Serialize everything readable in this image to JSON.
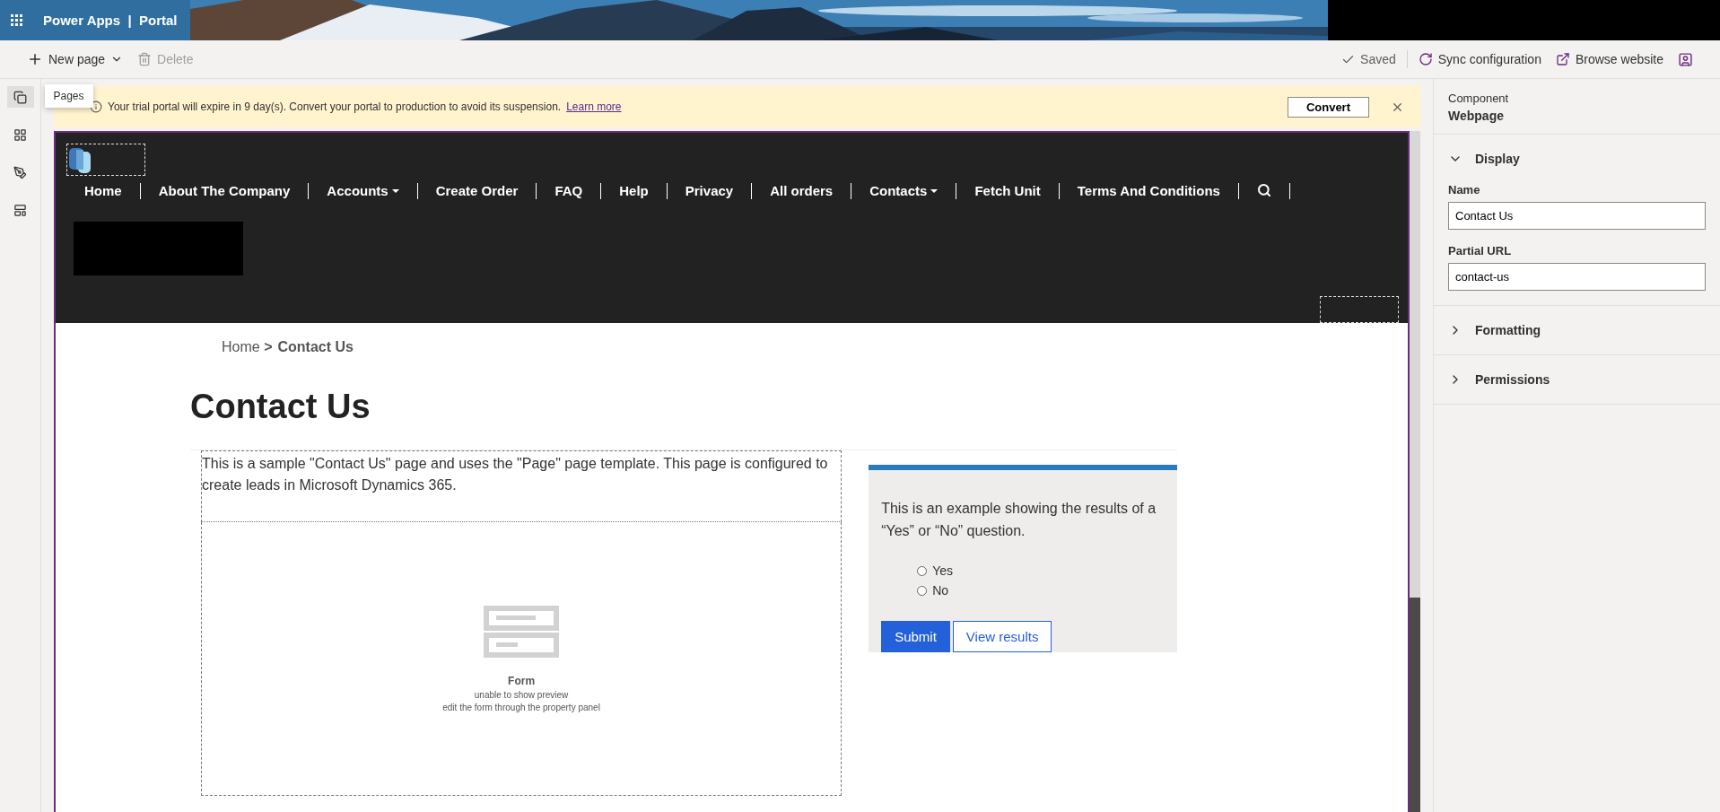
{
  "app_bar": {
    "product": "Power Apps",
    "separator": "|",
    "site": "Portal"
  },
  "toolbar": {
    "left": [
      {
        "kind": "add",
        "label": "New page",
        "disabled": false,
        "dropdown": true
      },
      {
        "kind": "delete",
        "label": "Delete",
        "disabled": true,
        "dropdown": false
      }
    ],
    "right": [
      {
        "kind": "saved",
        "label": "Saved"
      },
      {
        "kind": "sync",
        "label": "Sync configuration"
      },
      {
        "kind": "browse",
        "label": "Browse website"
      },
      {
        "kind": "feedback"
      }
    ]
  },
  "rail": [
    {
      "kind": "pages",
      "selected": true,
      "tooltip": "Pages"
    },
    {
      "kind": "components",
      "selected": false
    },
    {
      "kind": "themes",
      "selected": false
    },
    {
      "kind": "templates",
      "selected": false
    }
  ],
  "banner": {
    "message": "Your trial portal will expire in 9 day(s). Convert your portal to production to avoid its suspension.",
    "link": "Learn more",
    "button": "Convert"
  },
  "site_nav": [
    {
      "label": "Home",
      "dropdown": false
    },
    {
      "label": "About The Company",
      "dropdown": false
    },
    {
      "label": "Accounts",
      "dropdown": true
    },
    {
      "label": "Create Order",
      "dropdown": false
    },
    {
      "label": "FAQ",
      "dropdown": false
    },
    {
      "label": "Help",
      "dropdown": false
    },
    {
      "label": "Privacy",
      "dropdown": false
    },
    {
      "label": "All orders",
      "dropdown": false
    },
    {
      "label": "Contacts",
      "dropdown": true
    },
    {
      "label": "Fetch Unit",
      "dropdown": false
    },
    {
      "label": "Terms And Conditions",
      "dropdown": false
    }
  ],
  "breadcrumb": {
    "items": [
      "Home"
    ],
    "separator": ">",
    "current": "Contact Us"
  },
  "page_title": "Contact Us",
  "intro": "This is a sample \"Contact Us\" page and uses the \"Page\" page template. This page is configured to create leads in Microsoft Dynamics 365.",
  "form_placeholder": {
    "title": "Form",
    "lines": [
      "unable to show preview",
      "edit the form through the property panel"
    ]
  },
  "poll": {
    "question": "This is an example showing the results of a “Yes” or “No” question.",
    "options": [
      {
        "label": "Yes",
        "selected": false
      },
      {
        "label": "No",
        "selected": false
      }
    ],
    "submit": "Submit",
    "results": "View results"
  },
  "properties": {
    "caption": "Component",
    "type": "Webpage",
    "sections": [
      {
        "title": "Display",
        "expanded": true,
        "fields": [
          {
            "label": "Name",
            "value": "Contact Us"
          },
          {
            "label": "Partial URL",
            "value": "contact-us"
          }
        ]
      },
      {
        "title": "Formatting",
        "expanded": false
      },
      {
        "title": "Permissions",
        "expanded": false
      }
    ]
  }
}
